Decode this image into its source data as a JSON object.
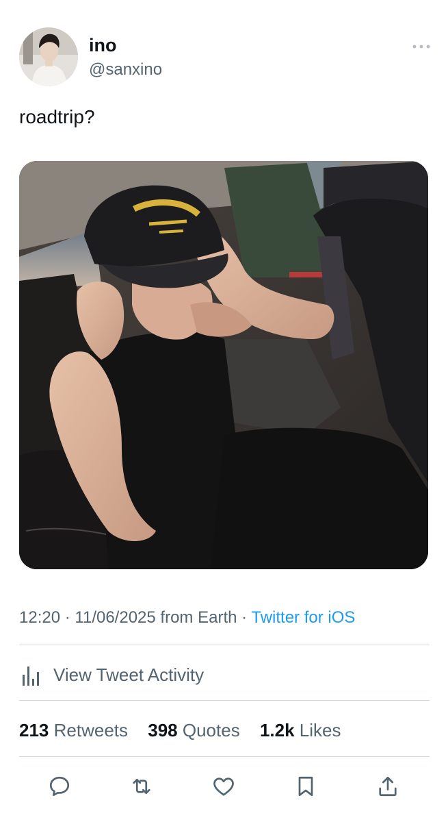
{
  "author": {
    "name": "ino",
    "handle": "@sanxino"
  },
  "tweet": {
    "text": "roadtrip?",
    "media_icon": "photo"
  },
  "meta": {
    "time": "12:20",
    "date": "11/06/2025",
    "location": "from Earth",
    "source": "Twitter for iOS"
  },
  "activity": {
    "label": "View Tweet Activity",
    "icon": "bar-chart-icon"
  },
  "stats": {
    "retweets_count": "213",
    "retweets_label": "Retweets",
    "quotes_count": "398",
    "quotes_label": "Quotes",
    "likes_count": "1.2k",
    "likes_label": "Likes"
  },
  "actions": {
    "icons": [
      "reply-icon",
      "retweet-icon",
      "like-icon",
      "bookmark-icon",
      "share-icon"
    ]
  },
  "colors": {
    "accent": "#1d9bf0",
    "secondary_text": "#536471",
    "divider": "#cfd9de"
  }
}
